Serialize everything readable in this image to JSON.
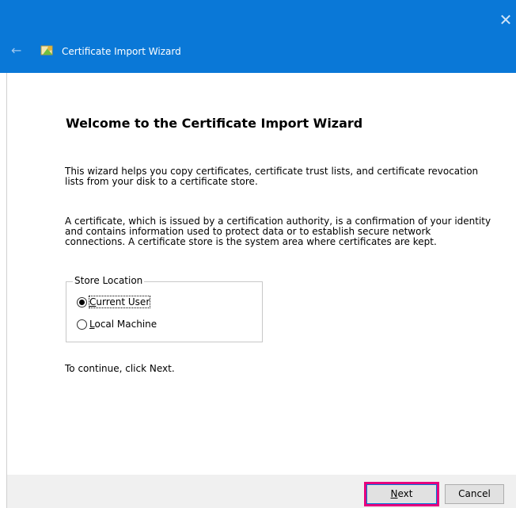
{
  "window": {
    "title": "Certificate Import Wizard",
    "close_glyph": "✕",
    "back_glyph": "←",
    "title_bar_color": "#0A78D7"
  },
  "page": {
    "heading": "Welcome to the Certificate Import Wizard",
    "para1": "This wizard helps you copy certificates, certificate trust lists, and certificate revocation lists from your disk to a certificate store.",
    "para2": "A certificate, which is issued by a certification authority, is a confirmation of your identity and contains information used to protect data or to establish secure network connections. A certificate store is the system area where certificates are kept.",
    "store_location": {
      "legend": "Store Location",
      "options": [
        {
          "label_first": "C",
          "label_rest": "urrent User",
          "selected": true
        },
        {
          "label_first": "L",
          "label_rest": "ocal Machine",
          "selected": false
        }
      ]
    },
    "continue_text": "To continue, click Next."
  },
  "buttons": {
    "next_first": "N",
    "next_rest": "ext",
    "cancel": "Cancel",
    "highlight_color": "#E6007E"
  },
  "icons": {
    "back": "back-arrow-icon",
    "wizard": "certificate-wizard-icon",
    "close": "close-icon"
  }
}
